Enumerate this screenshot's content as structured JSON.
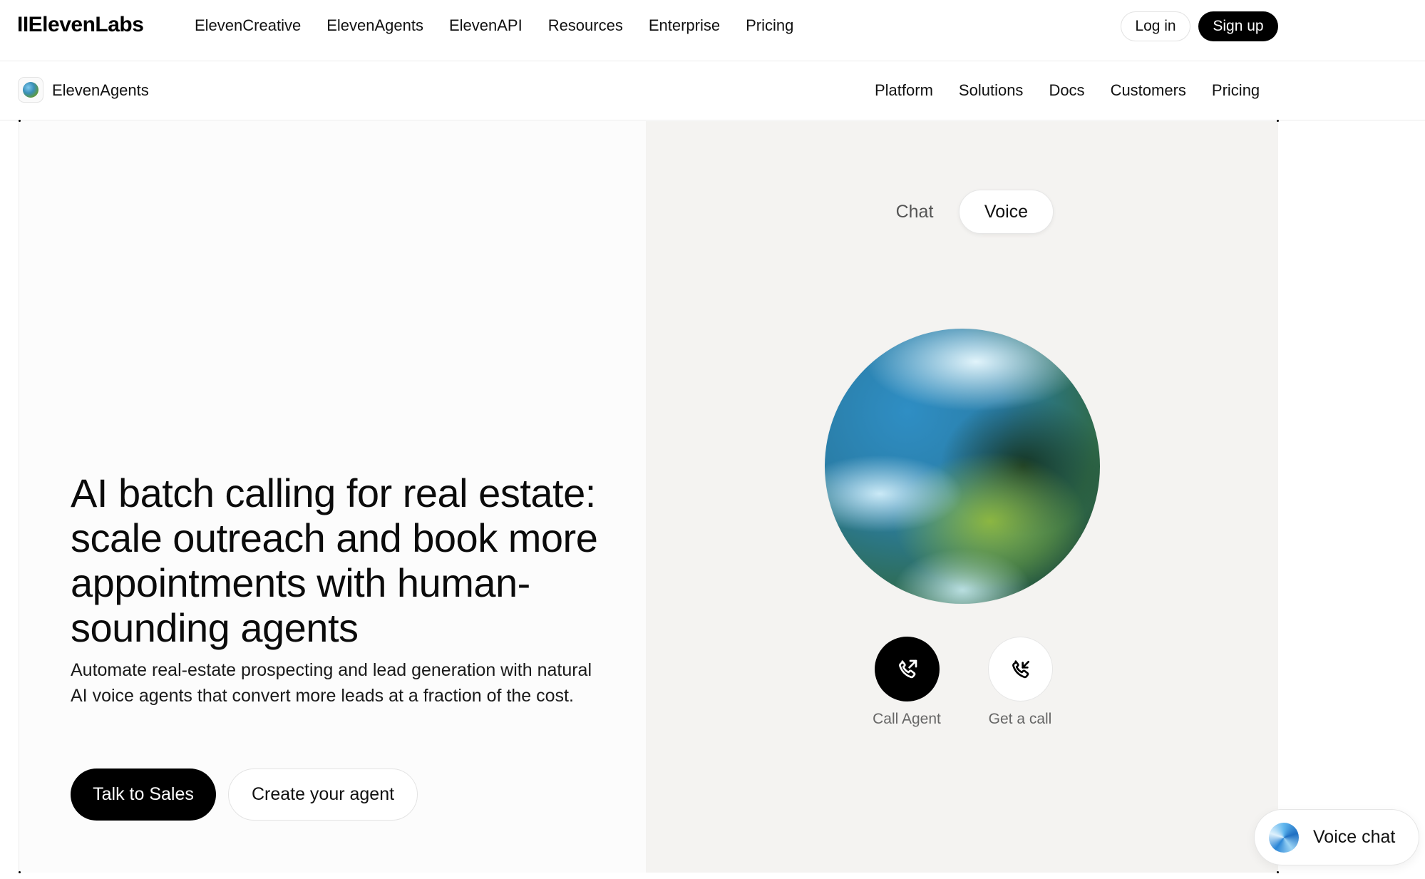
{
  "top_nav": {
    "logo": "IIElevenLabs",
    "links": [
      "ElevenCreative",
      "ElevenAgents",
      "ElevenAPI",
      "Resources",
      "Enterprise",
      "Pricing"
    ],
    "login_label": "Log in",
    "signup_label": "Sign up"
  },
  "sub_nav": {
    "title": "ElevenAgents",
    "links": [
      "Platform",
      "Solutions",
      "Docs",
      "Customers",
      "Pricing"
    ]
  },
  "hero": {
    "title": "AI batch calling for real estate: scale outreach and book more appointments with human-sounding agents",
    "subtitle": "Automate real-estate prospecting and lead generation with natural AI voice agents that convert more leads at a fraction of the cost.",
    "primary_cta": "Talk to Sales",
    "secondary_cta": "Create your agent"
  },
  "demo": {
    "tabs": [
      "Chat",
      "Voice"
    ],
    "selected_tab": "Voice",
    "call_agent_label": "Call Agent",
    "get_call_label": "Get a call"
  },
  "widget": {
    "label": "Voice chat"
  },
  "icons": {
    "call_agent": "phone-outgoing-icon",
    "get_call": "phone-incoming-icon"
  },
  "colors": {
    "primary": "#000000",
    "demo_background": "#f4f3f1"
  }
}
